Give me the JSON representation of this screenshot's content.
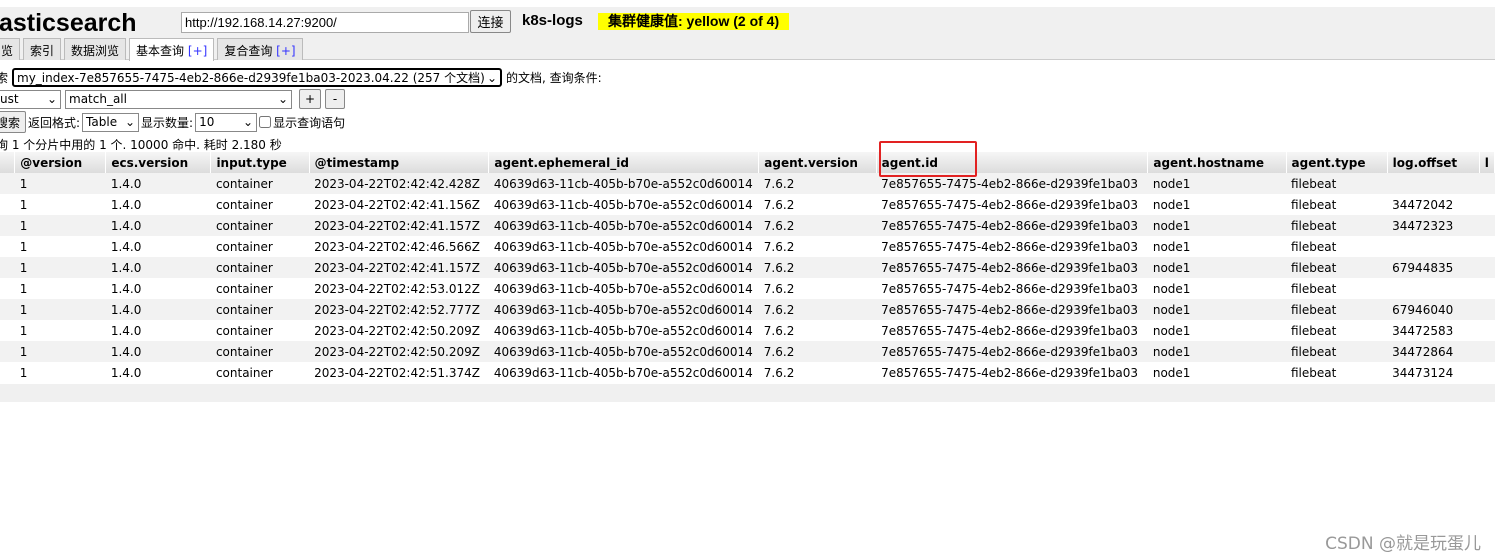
{
  "header": {
    "logo": "lasticsearch",
    "url": "http://192.168.14.27:9200/",
    "connect_label": "连接",
    "cluster_name": "k8s-logs",
    "health": "集群健康值: yellow (2 of 4)",
    "health_color": "#ffff00"
  },
  "tabs": [
    {
      "label": "览"
    },
    {
      "label": "索引"
    },
    {
      "label": "数据浏览"
    },
    {
      "label": "基本查询",
      "plus": "[+]"
    },
    {
      "label": "复合查询",
      "plus": "[+]"
    }
  ],
  "query": {
    "search_prefix": "索",
    "index_select": "my_index-7e857655-7475-4eb2-866e-d2939fe1ba03-2023.04.22 (257 个文档)",
    "index_suffix": "的文档,  查询条件:",
    "bool_select": "ust",
    "clause_select": "match_all",
    "add_label": "+",
    "remove_label": "-",
    "search_button": "搜索",
    "format_label": "返回格式:",
    "format_select": "Table",
    "size_label": "显示数量:",
    "size_select": "10",
    "show_query_label": "显示查询语句",
    "show_query_checked": false,
    "summary": "询 1 个分片中用的 1 个. 10000 命中. 耗时 2.180 秒"
  },
  "table": {
    "columns": [
      "",
      "@version",
      "ecs.version",
      "input.type",
      "@timestamp",
      "agent.ephemeral_id",
      "agent.version",
      "agent.id",
      "agent.hostname",
      "agent.type",
      "log.offset",
      "l"
    ],
    "rows": [
      [
        "",
        "1",
        "1.4.0",
        "container",
        "2023-04-22T02:42:42.428Z",
        "40639d63-11cb-405b-b70e-a552c0d60014",
        "7.6.2",
        "7e857655-7475-4eb2-866e-d2939fe1ba03",
        "node1",
        "filebeat",
        "",
        ""
      ],
      [
        "",
        "1",
        "1.4.0",
        "container",
        "2023-04-22T02:42:41.156Z",
        "40639d63-11cb-405b-b70e-a552c0d60014",
        "7.6.2",
        "7e857655-7475-4eb2-866e-d2939fe1ba03",
        "node1",
        "filebeat",
        "34472042",
        ""
      ],
      [
        "",
        "1",
        "1.4.0",
        "container",
        "2023-04-22T02:42:41.157Z",
        "40639d63-11cb-405b-b70e-a552c0d60014",
        "7.6.2",
        "7e857655-7475-4eb2-866e-d2939fe1ba03",
        "node1",
        "filebeat",
        "34472323",
        ""
      ],
      [
        "",
        "1",
        "1.4.0",
        "container",
        "2023-04-22T02:42:46.566Z",
        "40639d63-11cb-405b-b70e-a552c0d60014",
        "7.6.2",
        "7e857655-7475-4eb2-866e-d2939fe1ba03",
        "node1",
        "filebeat",
        "",
        ""
      ],
      [
        "",
        "1",
        "1.4.0",
        "container",
        "2023-04-22T02:42:41.157Z",
        "40639d63-11cb-405b-b70e-a552c0d60014",
        "7.6.2",
        "7e857655-7475-4eb2-866e-d2939fe1ba03",
        "node1",
        "filebeat",
        "67944835",
        ""
      ],
      [
        "",
        "1",
        "1.4.0",
        "container",
        "2023-04-22T02:42:53.012Z",
        "40639d63-11cb-405b-b70e-a552c0d60014",
        "7.6.2",
        "7e857655-7475-4eb2-866e-d2939fe1ba03",
        "node1",
        "filebeat",
        "",
        ""
      ],
      [
        "",
        "1",
        "1.4.0",
        "container",
        "2023-04-22T02:42:52.777Z",
        "40639d63-11cb-405b-b70e-a552c0d60014",
        "7.6.2",
        "7e857655-7475-4eb2-866e-d2939fe1ba03",
        "node1",
        "filebeat",
        "67946040",
        ""
      ],
      [
        "",
        "1",
        "1.4.0",
        "container",
        "2023-04-22T02:42:50.209Z",
        "40639d63-11cb-405b-b70e-a552c0d60014",
        "7.6.2",
        "7e857655-7475-4eb2-866e-d2939fe1ba03",
        "node1",
        "filebeat",
        "34472583",
        ""
      ],
      [
        "",
        "1",
        "1.4.0",
        "container",
        "2023-04-22T02:42:50.209Z",
        "40639d63-11cb-405b-b70e-a552c0d60014",
        "7.6.2",
        "7e857655-7475-4eb2-866e-d2939fe1ba03",
        "node1",
        "filebeat",
        "34472864",
        ""
      ],
      [
        "",
        "1",
        "1.4.0",
        "container",
        "2023-04-22T02:42:51.374Z",
        "40639d63-11cb-405b-b70e-a552c0d60014",
        "7.6.2",
        "7e857655-7475-4eb2-866e-d2939fe1ba03",
        "node1",
        "filebeat",
        "34473124",
        ""
      ]
    ]
  },
  "annotation": {
    "highlight_color": "#e22222"
  },
  "watermark": "CSDN @就是玩蛋儿"
}
